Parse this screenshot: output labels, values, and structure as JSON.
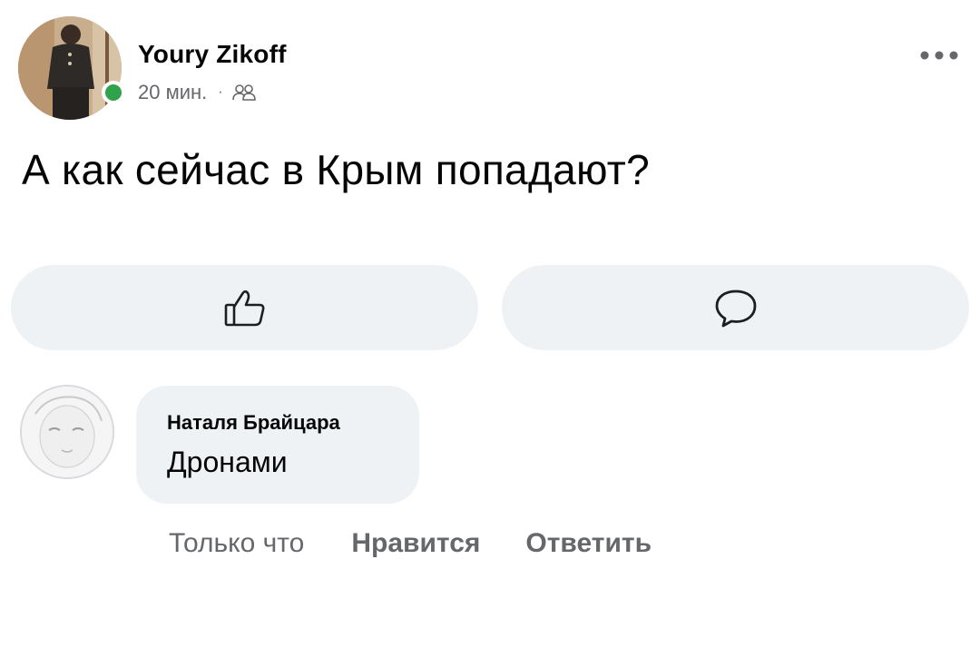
{
  "post": {
    "author": "Youry Zikoff",
    "time": "20 мин.",
    "separator": "·",
    "audience_icon": "friends-icon",
    "more_icon": "more-icon",
    "text": "А как сейчас в Крым попадают?",
    "online_color": "#31a24c"
  },
  "actions": {
    "like_icon": "thumbs-up-icon",
    "comment_icon": "comment-icon"
  },
  "comment": {
    "author": "Наталя Брайцара",
    "text": "Дронами",
    "time": "Только что",
    "like_label": "Нравится",
    "reply_label": "Ответить"
  }
}
